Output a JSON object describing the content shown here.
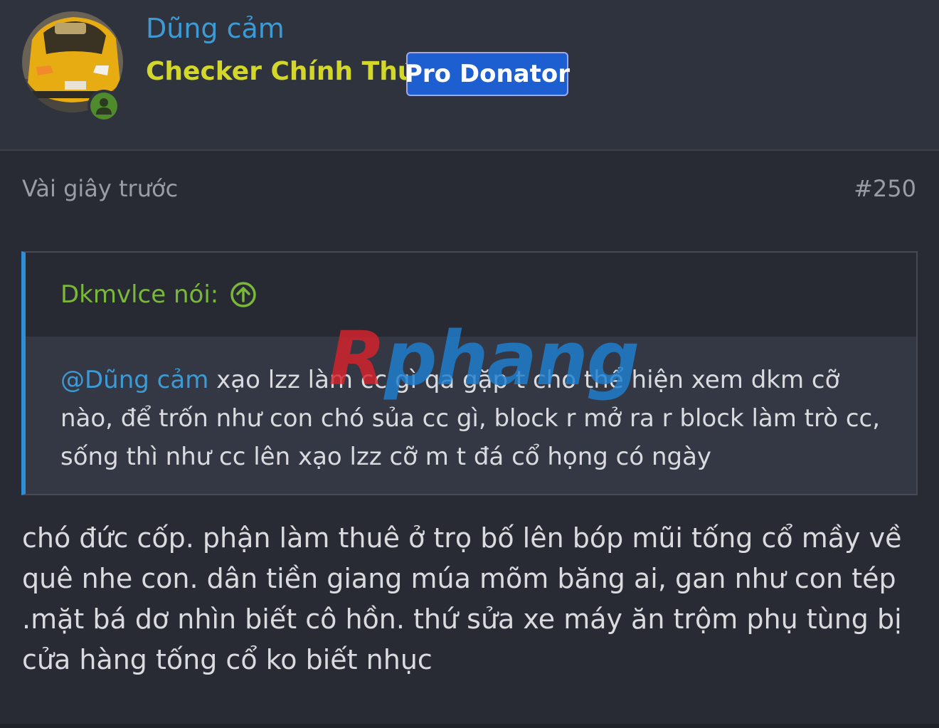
{
  "header": {
    "avatar_icon": "avatar-yellow-car",
    "online_status_icon": "user-online-icon",
    "username": "Dũng cảm",
    "user_title": "Checker Chính Thức",
    "badge": "Pro Donator"
  },
  "post": {
    "time": "Vài giây trước",
    "number": "#250"
  },
  "quote": {
    "author": "Dkmvlce nói:",
    "jump_icon": "arrow-up-circle-icon",
    "mention": "@Dũng cảm",
    "text": " xạo lzz làm cc gì qa gặp t cho thể hiện xem dkm cỡ nào, để trốn như con chó sủa cc gì, block r mở ra r block làm trò cc, sống thì như cc lên xạo lzz cỡ m t đá cổ họng có ngày"
  },
  "watermark": {
    "first": "R",
    "rest": "phang"
  },
  "message": {
    "text": "chó đức cốp. phận làm thuê ở trọ bố lên bóp mũi tống cổ mầy về quê nhe con. dân tiền giang múa mõm băng ai, gan như con tép .mặt bá dơ nhìn biết cô hồn. thứ sửa xe máy ăn trộm phụ tùng bị cửa hàng tống cổ ko biết nhục"
  },
  "colors": {
    "background": "#282b33",
    "username": "#3d9ad4",
    "title": "#d2d72a",
    "badge": "#1d5ed0",
    "quote_author": "#79b83a",
    "quote_border": "#2f8fd6"
  }
}
